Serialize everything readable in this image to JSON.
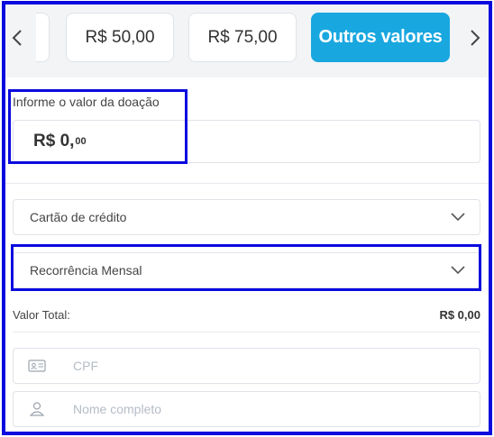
{
  "carousel": {
    "prev_label": "‹",
    "next_label": "›",
    "options": [
      {
        "label": "R$ 50,00"
      },
      {
        "label": "R$ 75,00"
      },
      {
        "label": "Outros valores",
        "selected": true
      }
    ]
  },
  "donation": {
    "label": "Informe o valor da doação",
    "amount_main": "R$ 0,",
    "amount_cents": "00"
  },
  "payment_method": {
    "selected": "Cartão de crédito"
  },
  "recurrence": {
    "selected": "Recorrência Mensal"
  },
  "total": {
    "label": "Valor Total:",
    "value": "R$ 0,00"
  },
  "cpf": {
    "placeholder": "CPF",
    "icon": "id-card-icon"
  },
  "name": {
    "placeholder": "Nome completo",
    "icon": "user-icon"
  },
  "colors": {
    "accent": "#19a7e0",
    "highlight": "#0a0adf",
    "border": "#dfe3e8"
  }
}
